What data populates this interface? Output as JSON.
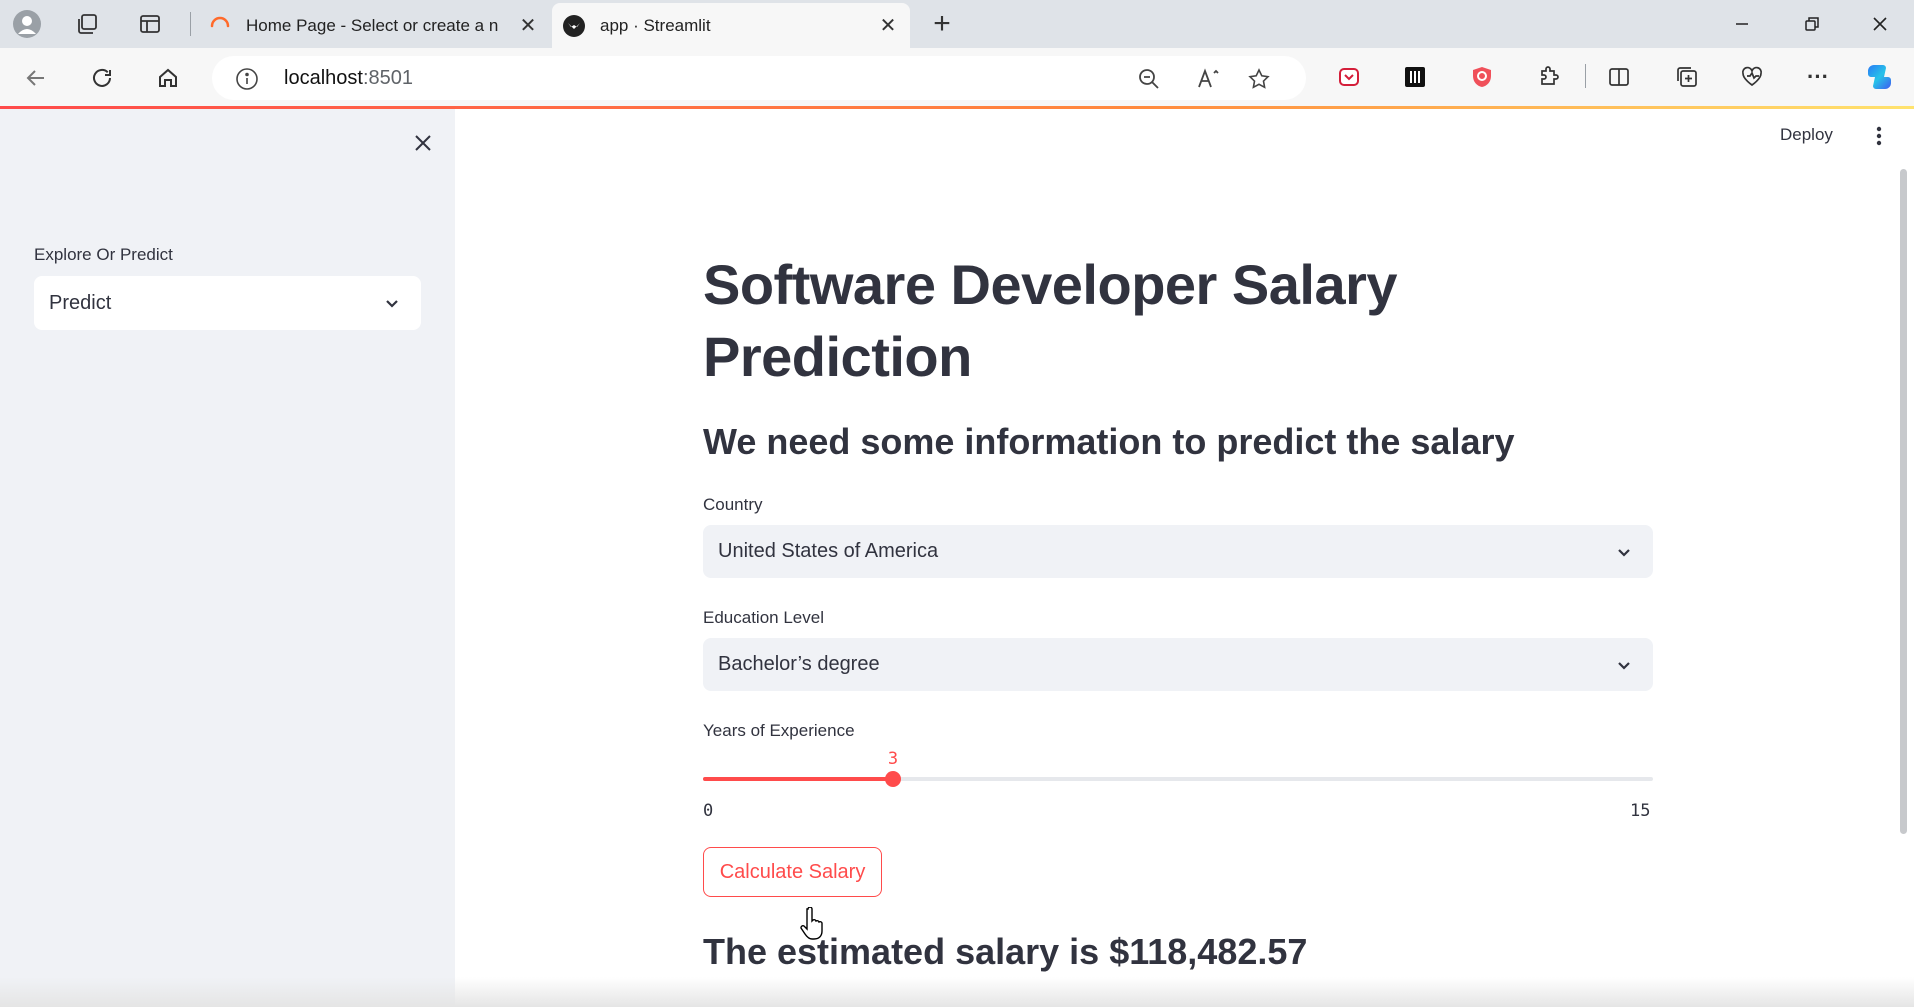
{
  "browser": {
    "tabs": [
      {
        "title": "Home Page - Select or create a n"
      },
      {
        "title": "app · Streamlit"
      }
    ],
    "url": {
      "host": "localhost",
      "port": ":8501"
    }
  },
  "header": {
    "deploy_label": "Deploy"
  },
  "sidebar": {
    "select_label": "Explore Or Predict",
    "select_value": "Predict"
  },
  "main": {
    "title": "Software Developer Salary Prediction",
    "subtitle": "We need some information to predict the salary",
    "country": {
      "label": "Country",
      "value": "United States of America"
    },
    "education": {
      "label": "Education Level",
      "value": "Bachelor’s degree"
    },
    "experience": {
      "label": "Years of Experience",
      "value": "3",
      "min": "0",
      "max": "15",
      "fraction": 0.2
    },
    "button_label": "Calculate Salary",
    "result": "The estimated salary is $118,482.57"
  },
  "colors": {
    "accent": "#ff4b4b",
    "sidebar_bg": "#f0f2f6",
    "text": "#31333f"
  }
}
